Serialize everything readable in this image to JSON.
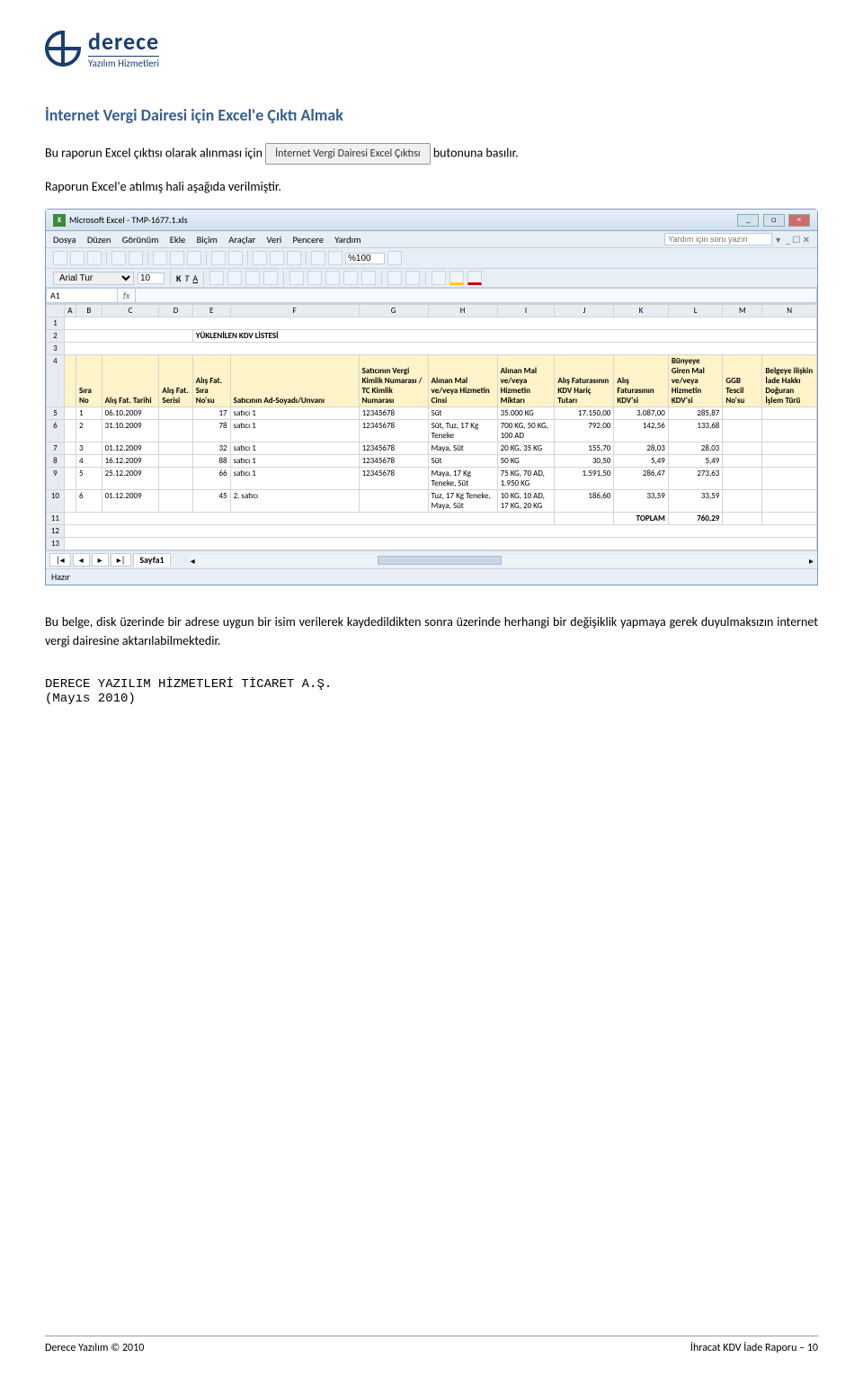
{
  "logo": {
    "brand": "derece",
    "sub": "Yazılım Hizmetleri"
  },
  "h1": "İnternet Vergi Dairesi için Excel'e Çıktı Almak",
  "p1a": "Bu raporun Excel çıktısı olarak alınması için",
  "button_label": "İnternet Vergi Dairesi Excel Çıktısı",
  "p1b": "butonuna basılır.",
  "p2": "Raporun Excel'e atılmış hali aşağıda verilmiştir.",
  "excel": {
    "title": "Microsoft Excel - TMP-1677.1.xls",
    "menus": [
      "Dosya",
      "Düzen",
      "Görünüm",
      "Ekle",
      "Biçim",
      "Araçlar",
      "Veri",
      "Pencere",
      "Yardım"
    ],
    "help_placeholder": "Yardım için soru yazın",
    "toolbar_zoom": "%100",
    "font": "Arial Tur",
    "size": "10",
    "namebox": "A1",
    "cols": [
      "A",
      "B",
      "C",
      "D",
      "E",
      "F",
      "G",
      "H",
      "I",
      "J",
      "K",
      "L",
      "M",
      "N"
    ],
    "row2_f": "YÜKLENİLEN KDV LİSTESİ",
    "hdr": {
      "b": "Sıra No",
      "c": "Alış Fat. Tarihi",
      "d": "Alış Fat. Serisi",
      "e": "Alış Fat. Sıra No'su",
      "f": "Satıcının Ad-Soyadı/Unvanı",
      "g": "Satıcının Vergi Kimlik Numarası / TC Kimlik Numarası",
      "h": "Alınan Mal ve/veya Hizmetin Cinsi",
      "i": "Alınan Mal ve/veya Hizmetin Miktarı",
      "j": "Alış Faturasının KDV Hariç Tutarı",
      "k": "Alış Faturasının KDV'si",
      "l": "Bünyeye Giren Mal ve/veya Hizmetin KDV'si",
      "m": "GGB Tescil No'su",
      "n": "Belgeye ilişkin İade Hakkı Doğuran İşlem Türü"
    },
    "rows": [
      {
        "r": "5",
        "b": "1",
        "c": "06.10.2009",
        "d": "",
        "e": "17",
        "f": "satıcı 1",
        "g": "12345678",
        "h": "Süt",
        "i": "35.000 KG",
        "j": "17.150,00",
        "k": "3.087,00",
        "l": "285,87"
      },
      {
        "r": "6",
        "b": "2",
        "c": "31.10.2009",
        "d": "",
        "e": "78",
        "f": "satıcı 1",
        "g": "12345678",
        "h": "Süt, Tuz, 17 Kg Teneke",
        "i": "700 KG, 50 KG, 100 AD",
        "j": "792,00",
        "k": "142,56",
        "l": "133,68"
      },
      {
        "r": "7",
        "b": "3",
        "c": "01.12.2009",
        "d": "",
        "e": "32",
        "f": "satıcı 1",
        "g": "12345678",
        "h": "Maya, Süt",
        "i": "20 KG, 35 KG",
        "j": "155,70",
        "k": "28,03",
        "l": "28,03"
      },
      {
        "r": "8",
        "b": "4",
        "c": "16.12.2009",
        "d": "",
        "e": "88",
        "f": "satıcı 1",
        "g": "12345678",
        "h": "Süt",
        "i": "50 KG",
        "j": "30,50",
        "k": "5,49",
        "l": "5,49"
      },
      {
        "r": "9",
        "b": "5",
        "c": "25.12.2009",
        "d": "",
        "e": "66",
        "f": "satıcı 1",
        "g": "12345678",
        "h": "Maya, 17 Kg Teneke, Süt",
        "i": "75 KG, 70 AD, 1.950 KG",
        "j": "1.591,50",
        "k": "286,47",
        "l": "273,63"
      },
      {
        "r": "10",
        "b": "6",
        "c": "01.12.2009",
        "d": "",
        "e": "45",
        "f": "2. satıcı",
        "g": "",
        "h": "Tuz, 17 Kg Teneke, Maya, Süt",
        "i": "10 KG, 10 AD, 17 KG, 20 KG",
        "j": "186,60",
        "k": "33,59",
        "l": "33,59"
      }
    ],
    "total_label": "TOPLAM",
    "total_val": "760,29",
    "sheet": "Sayfa1",
    "status": "Hazır"
  },
  "p3": "Bu belge, disk üzerinde bir adrese uygun bir isim verilerek kaydedildikten sonra üzerinde herhangi bir değişiklik yapmaya gerek duyulmaksızın internet vergi dairesine aktarılabilmektedir.",
  "s_line1": "DERECE YAZILIM HİZMETLERİ TİCARET A.Ş.",
  "s_line2": "(Mayıs 2010)",
  "footer_l": "Derece Yazılım © 2010",
  "footer_r": "İhracat KDV İade Raporu – 10"
}
